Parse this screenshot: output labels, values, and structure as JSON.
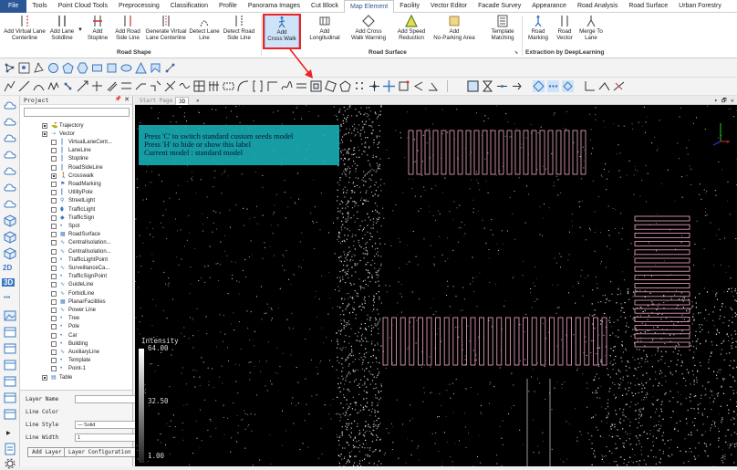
{
  "menu": {
    "items": [
      "File",
      "Tools",
      "Point Cloud Tools",
      "Preprocessing",
      "Classification",
      "Profile",
      "Panorama Images",
      "Cut Block",
      "Map Element",
      "Facility",
      "Vector Editor",
      "Facade Survey",
      "Appearance",
      "Road Analysis",
      "Road Surface",
      "Urban Forestry"
    ],
    "active": "Map Element"
  },
  "ribbon": {
    "buttons": [
      {
        "line1": "Add Virtual Lane",
        "line2": "Centerline"
      },
      {
        "line1": "Add Lane",
        "line2": "Solidline"
      },
      {
        "line1": "Add",
        "line2": "Stopline"
      },
      {
        "line1": "Add Road",
        "line2": "Side Line"
      },
      {
        "line1": "Generate Virtual",
        "line2": "Lane Centerline"
      },
      {
        "line1": "Detect Lane",
        "line2": "Line"
      },
      {
        "line1": "Detect Road",
        "line2": "Side Line"
      },
      {
        "line1": "Add",
        "line2": "Cross Walk"
      },
      {
        "line1": "Add",
        "line2": "Longitudinal"
      },
      {
        "line1": "Add Cross",
        "line2": "Walk Warning"
      },
      {
        "line1": "Add Speed",
        "line2": "Reduction"
      },
      {
        "line1": "Add",
        "line2": "No-Parking Area"
      },
      {
        "line1": "Template",
        "line2": "Matching"
      },
      {
        "line1": "Road",
        "line2": "Marking"
      },
      {
        "line1": "Road",
        "line2": "Vector"
      },
      {
        "line1": "Merge To",
        "line2": "Lane"
      }
    ],
    "groups": [
      "Road Shape",
      "Road Surface",
      "Extraction by DeepLearning"
    ]
  },
  "project": {
    "title": "Project",
    "tree": [
      {
        "label": "Trajectory",
        "level": 1,
        "checked": true,
        "icon": "trajectory-icon"
      },
      {
        "label": "Vector",
        "level": 1,
        "checked": true,
        "icon": "vector-icon"
      },
      {
        "label": "VirtualLaneCent...",
        "level": 2,
        "checked": false,
        "icon": "lane-icon"
      },
      {
        "label": "LaneLine",
        "level": 2,
        "checked": false,
        "icon": "lane-icon"
      },
      {
        "label": "Stopline",
        "level": 2,
        "checked": false,
        "icon": "lane-icon"
      },
      {
        "label": "RoadSideLine",
        "level": 2,
        "checked": false,
        "icon": "lane-icon"
      },
      {
        "label": "Crosswalk",
        "level": 2,
        "checked": true,
        "icon": "crosswalk-icon"
      },
      {
        "label": "RoadMarking",
        "level": 2,
        "checked": false,
        "icon": "marking-icon"
      },
      {
        "label": "UtilityPole",
        "level": 2,
        "checked": false,
        "icon": "pole-icon"
      },
      {
        "label": "StreetLight",
        "level": 2,
        "checked": false,
        "icon": "light-icon"
      },
      {
        "label": "TrafficLight",
        "level": 2,
        "checked": false,
        "icon": "trafficlight-icon"
      },
      {
        "label": "TrafficSign",
        "level": 2,
        "checked": false,
        "icon": "sign-icon"
      },
      {
        "label": "Spot",
        "level": 2,
        "checked": false,
        "icon": "point-icon"
      },
      {
        "label": "RoadSurface",
        "level": 2,
        "checked": false,
        "icon": "surface-icon"
      },
      {
        "label": "CentralIsolation...",
        "level": 2,
        "checked": false,
        "icon": "line-icon"
      },
      {
        "label": "CentralIsolation...",
        "level": 2,
        "checked": false,
        "icon": "line-icon"
      },
      {
        "label": "TrafficLightPoint",
        "level": 2,
        "checked": false,
        "icon": "point-icon"
      },
      {
        "label": "SurveillanceCa...",
        "level": 2,
        "checked": false,
        "icon": "line-icon"
      },
      {
        "label": "TrafficSignPoint",
        "level": 2,
        "checked": false,
        "icon": "point-icon"
      },
      {
        "label": "GuideLine",
        "level": 2,
        "checked": false,
        "icon": "line-icon"
      },
      {
        "label": "ForbidLine",
        "level": 2,
        "checked": false,
        "icon": "line-icon"
      },
      {
        "label": "PlanarFacilities",
        "level": 2,
        "checked": false,
        "icon": "surface-icon"
      },
      {
        "label": "Power Line",
        "level": 2,
        "checked": false,
        "icon": "line-icon"
      },
      {
        "label": "Tree",
        "level": 2,
        "checked": false,
        "icon": "point-icon"
      },
      {
        "label": "Pole",
        "level": 2,
        "checked": false,
        "icon": "point-icon"
      },
      {
        "label": "Car",
        "level": 2,
        "checked": false,
        "icon": "point-icon"
      },
      {
        "label": "Building",
        "level": 2,
        "checked": false,
        "icon": "point-icon"
      },
      {
        "label": "AuxiliaryLine",
        "level": 2,
        "checked": false,
        "icon": "line-icon"
      },
      {
        "label": "Template",
        "level": 2,
        "checked": false,
        "icon": "point-icon"
      },
      {
        "label": "Point-1",
        "level": 2,
        "checked": false,
        "icon": "point-icon"
      },
      {
        "label": "Table",
        "level": 1,
        "checked": true,
        "icon": "table-icon"
      }
    ]
  },
  "properties": {
    "layer_name_label": "Layer Name",
    "line_color_label": "Line Color",
    "line_style_label": "Line Style",
    "line_style_value": "— Solid",
    "line_width_label": "Line Width",
    "line_width_value": "1",
    "add_layer_label": "Add Layer",
    "layer_config_label": "Layer Configuration"
  },
  "viewport": {
    "tabs": [
      "Start Page",
      "3D"
    ],
    "active_tab": "3D",
    "info_lines": [
      "Press 'C' to switch standard custom seeds model",
      "Press 'H' to hide or show this label",
      "Current model : standard model"
    ],
    "intensity_title": "Intensity",
    "intensity_max": "64.00",
    "intensity_mid": "32.50",
    "intensity_min": "1.00"
  },
  "leftbar": {
    "label_2d": "2D",
    "label_3d": "3D"
  },
  "colors": {
    "accent": "#2b5797",
    "highlight": "#e22222",
    "crosswalk": "#f4a8c8",
    "info_box": "#1ab8c0"
  }
}
